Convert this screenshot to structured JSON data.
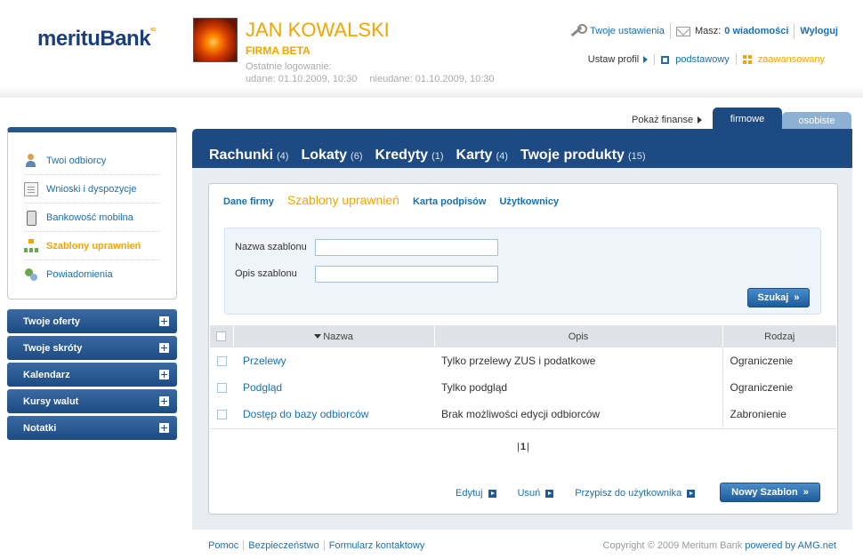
{
  "brand": {
    "logo_part1": "meritu",
    "logo_part2": "Bank",
    "logo_mark": "ю"
  },
  "user": {
    "name": "JAN KOWALSKI",
    "company": "FIRMA BETA",
    "last_login_label": "Ostatnie logowanie:",
    "login_ok": "udane: 01.10.2009, 10:30",
    "login_failed": "nieudane: 01.10.2009, 10:30"
  },
  "topnav": {
    "settings": "Twoje ustawienia",
    "messages_prefix": "Masz:",
    "messages_link": "0 wiadomości",
    "logout": "Wyloguj"
  },
  "profile": {
    "label": "Ustaw profil",
    "basic": "podstawowy",
    "advanced": "zaawansowany"
  },
  "sidebar": {
    "items": [
      {
        "label": "Twoi odbiorcy",
        "icon": "person-icon"
      },
      {
        "label": "Wnioski i dyspozycje",
        "icon": "document-icon"
      },
      {
        "label": "Bankowość mobilna",
        "icon": "mobile-icon"
      },
      {
        "label": "Szablony uprawnień",
        "icon": "hierarchy-icon",
        "active": true
      },
      {
        "label": "Powiadomienia",
        "icon": "notification-icon"
      }
    ],
    "accordions": [
      "Twoje oferty",
      "Twoje skróty",
      "Kalendarz",
      "Kursy walut",
      "Notatki"
    ]
  },
  "finance": {
    "show_label": "Pokaż finanse",
    "tab_company": "firmowe",
    "tab_personal": "osobiste"
  },
  "main_tabs": [
    {
      "label": "Rachunki",
      "count": "(4)"
    },
    {
      "label": "Lokaty",
      "count": "(6)"
    },
    {
      "label": "Kredyty",
      "count": "(1)"
    },
    {
      "label": "Karty",
      "count": "(4)"
    },
    {
      "label": "Twoje produkty",
      "count": "(15)"
    }
  ],
  "sub_tabs": [
    {
      "label": "Dane firmy"
    },
    {
      "label": "Szablony uprawnień",
      "active": true
    },
    {
      "label": "Karta podpisów"
    },
    {
      "label": "Użytkownicy"
    }
  ],
  "search": {
    "name_label": "Nazwa szablonu",
    "name_value": "",
    "desc_label": "Opis szablonu",
    "desc_value": "",
    "button": "Szukaj"
  },
  "table": {
    "headers": {
      "name": "Nazwa",
      "desc": "Opis",
      "type": "Rodzaj"
    },
    "rows": [
      {
        "name": "Przelewy",
        "desc": "Tylko przelewy ZUS i podatkowe",
        "type": "Ograniczenie"
      },
      {
        "name": "Podgląd",
        "desc": "Tylko podgląd",
        "type": "Ograniczenie"
      },
      {
        "name": "Dostęp do bazy odbiorców",
        "desc": "Brak możliwości edycji odbiorców",
        "type": "Zabronienie"
      }
    ]
  },
  "pager": {
    "current": "1"
  },
  "actions": {
    "edit": "Edytuj",
    "delete": "Usuń",
    "assign": "Przypisz do użytkownika",
    "new": "Nowy Szablon"
  },
  "footer": {
    "links": [
      "Pomoc",
      "Bezpieczeństwo",
      "Formularz kontaktowy"
    ],
    "copyright": "Copyright © 2009 Meritum Bank",
    "powered": "powered by AMG.net"
  },
  "colors": {
    "brand_blue": "#1d4a82",
    "accent_orange": "#f0a500",
    "link_blue": "#1a6fb0"
  }
}
